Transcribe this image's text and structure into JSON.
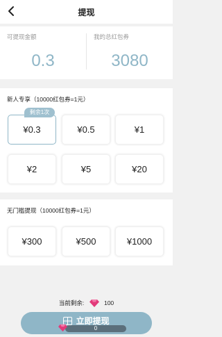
{
  "header": {
    "title": "提现"
  },
  "summary": {
    "withdrawable_label": "可提现金额",
    "withdrawable_value": "0.3",
    "total_coupon_label": "我的总红包券",
    "total_coupon_value": "3080"
  },
  "newuser": {
    "title": "新人专享（10000红包券=1元）",
    "badge": "剩余1次",
    "options": [
      "¥0.3",
      "¥0.5",
      "¥1",
      "¥2",
      "¥5",
      "¥20"
    ]
  },
  "nothreshold": {
    "title": "无门槛提现（10000红包券=1元）",
    "options": [
      "¥300",
      "¥500",
      "¥1000"
    ]
  },
  "bottom": {
    "remain_label": "当前剩余:",
    "remain_value": "100",
    "button_label": "立即提现",
    "progress_value": "0",
    "progress_fraction": 0
  },
  "colors": {
    "accent": "#8fb6c7",
    "gem": "#e23b7a"
  }
}
